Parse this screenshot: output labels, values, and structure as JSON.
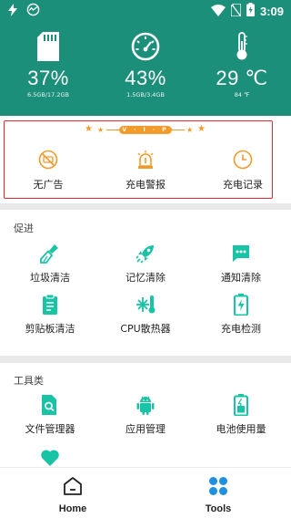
{
  "status_bar": {
    "time": "3:09",
    "icons": [
      "flash-icon",
      "speedometer-icon",
      "wifi-icon",
      "no-sim-icon",
      "battery-charging-icon"
    ]
  },
  "header": {
    "stats": [
      {
        "icon": "sd-card-icon",
        "value": "37%",
        "detail": "6.5GB/17.2GB"
      },
      {
        "icon": "speedometer-icon",
        "value": "43%",
        "detail": "1.5GB/3.4GB"
      },
      {
        "icon": "thermometer-icon",
        "value": "29 ℃",
        "detail": "84 ℉"
      }
    ]
  },
  "vip": {
    "badge": "V · I · P",
    "items": [
      {
        "icon": "no-ads-icon",
        "label": "无广告"
      },
      {
        "icon": "alarm-light-icon",
        "label": "充电警报"
      },
      {
        "icon": "clock-icon",
        "label": "充电记录"
      }
    ]
  },
  "boost": {
    "title": "促进",
    "items": [
      {
        "icon": "broom-icon",
        "label": "垃圾清洁"
      },
      {
        "icon": "rocket-icon",
        "label": "记忆清除"
      },
      {
        "icon": "chat-dots-icon",
        "label": "通知清除"
      },
      {
        "icon": "clipboard-icon",
        "label": "剪贴板清洁"
      },
      {
        "icon": "snowflake-thermometer-icon",
        "label": "CPU散热器"
      },
      {
        "icon": "battery-check-icon",
        "label": "充电检测"
      }
    ]
  },
  "tools": {
    "title": "工具类",
    "items": [
      {
        "icon": "file-search-icon",
        "label": "文件管理器"
      },
      {
        "icon": "android-icon",
        "label": "应用管理"
      },
      {
        "icon": "battery-usage-icon",
        "label": "电池使用量"
      },
      {
        "icon": "heart-icon",
        "label": ""
      }
    ]
  },
  "nav": {
    "home_label": "Home",
    "tools_label": "Tools"
  },
  "colors": {
    "header_bg": "#1c8f7b",
    "accent": "#19c3a5",
    "vip_orange": "#f39b2a",
    "vip_border": "#e42a2a",
    "nav_active": "#1f8fe0"
  }
}
